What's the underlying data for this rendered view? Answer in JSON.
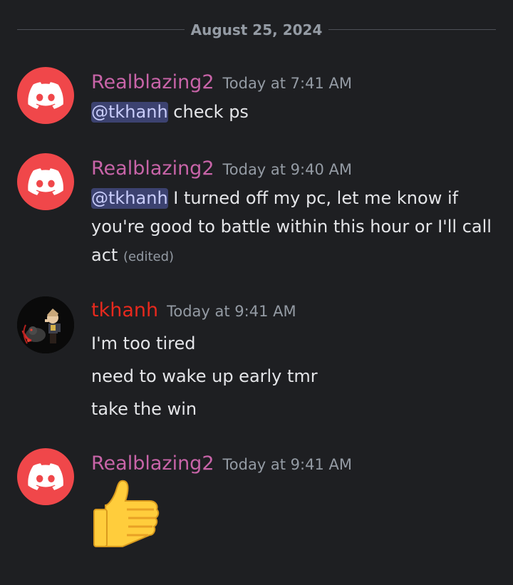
{
  "divider": {
    "date": "August 25, 2024"
  },
  "messages": [
    {
      "username": "Realblazing2",
      "timestamp": "Today at 7:41 AM",
      "mention": "@tkhanh",
      "text": "check ps"
    },
    {
      "username": "Realblazing2",
      "timestamp": "Today at 9:40 AM",
      "mention": "@tkhanh",
      "text_line1": "I turned off my pc, let me know if",
      "text_line2": "you're good to battle within this hour or I'll call",
      "text_line3": "act",
      "edited": "(edited)"
    },
    {
      "username": "tkhanh",
      "timestamp": "Today at 9:41 AM",
      "lines": [
        "I'm too tired",
        "need to wake up early tmr",
        "take the win"
      ]
    },
    {
      "username": "Realblazing2",
      "timestamp": "Today at 9:41 AM",
      "emoji": "👍"
    }
  ],
  "colors": {
    "background": "#1e1f22",
    "username_pink": "#c864a8",
    "username_red": "#e8291d",
    "mention_bg": "#3c4270",
    "discord_red": "#f0474a"
  },
  "icons": {
    "default_avatar": "discord-logo-icon"
  }
}
